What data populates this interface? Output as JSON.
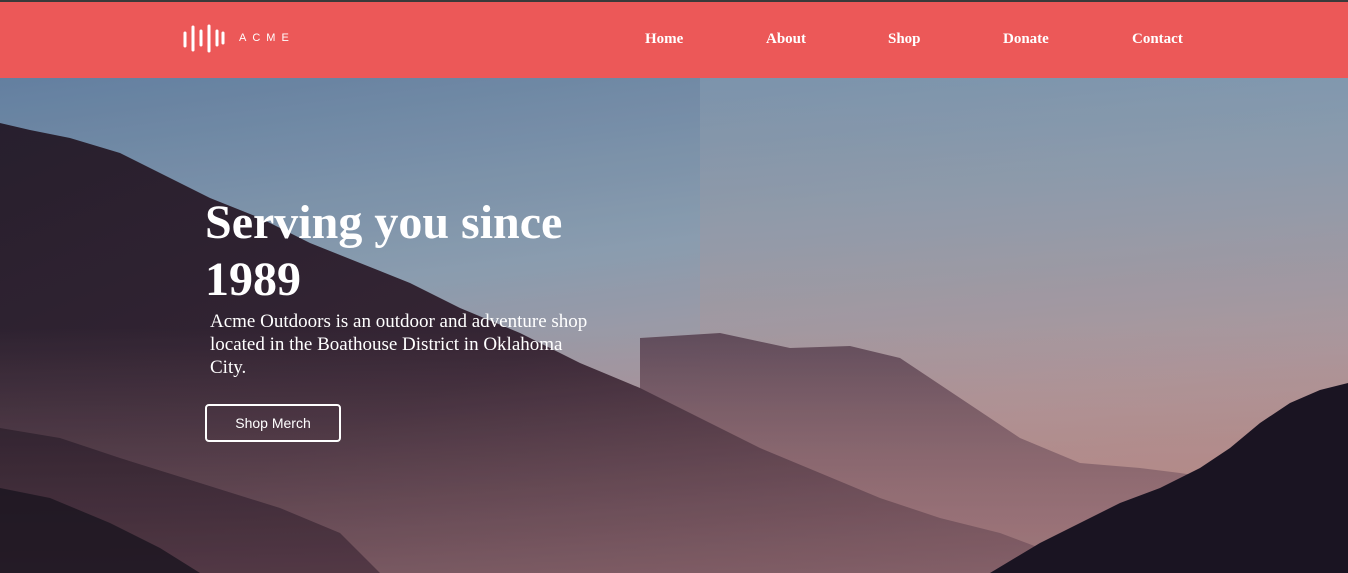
{
  "brand": {
    "name": "ACME",
    "logo_icon": "sound-bars-icon",
    "color": "#ec5858"
  },
  "nav": {
    "items": [
      {
        "label": "Home"
      },
      {
        "label": "About"
      },
      {
        "label": "Shop"
      },
      {
        "label": "Donate"
      },
      {
        "label": "Contact"
      }
    ]
  },
  "hero": {
    "title": "Serving you since 1989",
    "description": "Acme Outdoors is an outdoor and adventure shop located in the Boathouse District in Oklahoma City.",
    "button_label": "Shop Merch",
    "background": "mountain-dusk-landscape"
  }
}
